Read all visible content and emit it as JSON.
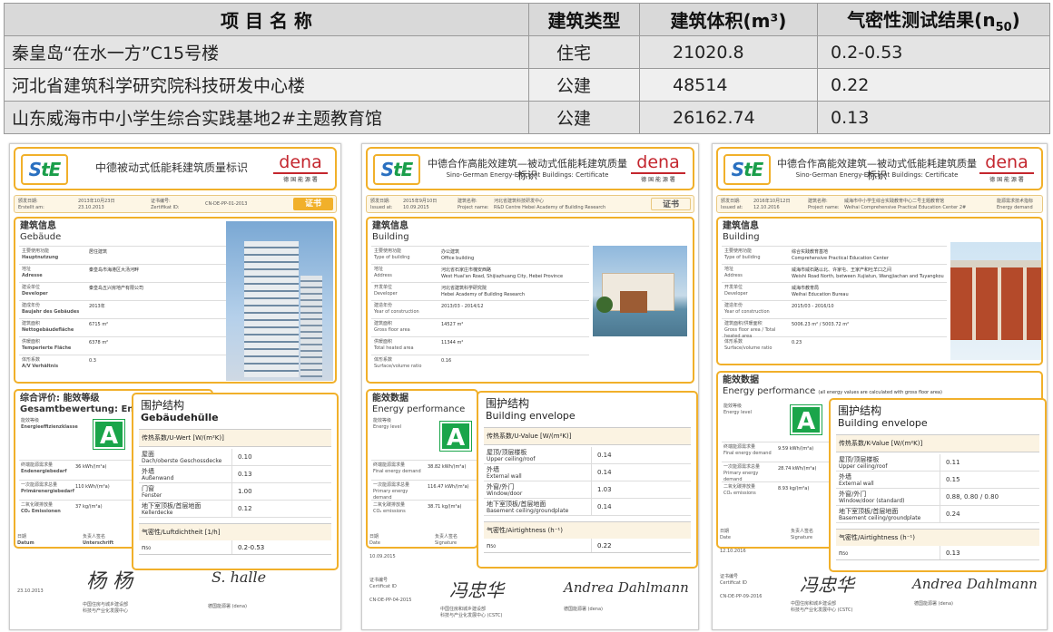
{
  "table": {
    "headers": [
      "项 目 名 称",
      "建筑类型",
      "建筑体积(m³)",
      "气密性测试结果(n",
      "50",
      ")"
    ],
    "rows": [
      {
        "name": "秦皇岛“在水一方”C15号楼",
        "type": "住宅",
        "volume": "21020.8",
        "result": "0.2-0.53"
      },
      {
        "name": "河北省建筑科学研究院科技研发中心楼",
        "type": "公建",
        "volume": "48514",
        "result": "0.22"
      },
      {
        "name": "山东威海市中小学生综合实践基地2#主题教育馆",
        "type": "公建",
        "volume": "26162.74",
        "result": "0.13"
      }
    ]
  },
  "cert1": {
    "title": "中德被动式低能耗建筑质量标识",
    "meta": [
      "颁发日期:",
      "Erstellt am:",
      "2013年10月23日",
      "23.10.2013",
      "证书编号:",
      "Zertifikat ID:",
      "CN-DE-PP-01-2013"
    ],
    "badge": "证书",
    "building_title": "建筑信息",
    "building_title_en": "Gebäude",
    "rows": [
      {
        "k": "主要使用功能",
        "k_en": "Hauptnutzung",
        "v": "居住建筑"
      },
      {
        "k": "地址",
        "k_en": "Adresse",
        "v": "秦皇岛市海港区大汤河畔"
      },
      {
        "k": "建设单位",
        "k_en": "Developer",
        "v": "秦皇岛五兴房地产有限公司"
      },
      {
        "k": "建成年份",
        "k_en": "Baujahr des Gebäudes",
        "v": "2013年"
      },
      {
        "k": "建筑面积",
        "k_en": "Nettogebäudefläche",
        "v": "6715 m²"
      },
      {
        "k": "供暖面积",
        "k_en": "Temperierte Fläche",
        "v": "6378 m²"
      },
      {
        "k": "体形系数",
        "k_en": "A/V Verhältnis",
        "v": "0.3"
      }
    ],
    "eval_title": "综合评价: 能效等级",
    "eval_title_en": "Gesamtbewertung: Energie",
    "eval_label": "能效等级",
    "eval_label_en": "Energieeffizienzklasse",
    "grade": "A",
    "eval_rows": [
      {
        "k": "终端能源需求量",
        "k_en": "Endenergiebedarf",
        "v": "36 kWh/(m²a)"
      },
      {
        "k": "一次能源需求总量",
        "k_en": "Primärenergiebedarf",
        "v": "110 kWh/(m²a)"
      },
      {
        "k": "二氧化碳排放量",
        "k_en": "CO₂ Emissionen",
        "v": "37 kg/(m²a)"
      }
    ],
    "env_title": "围护结构",
    "env_title_en": "Gebäudehülle",
    "env_head": "传热系数/U-Wert [W/(m²K)]",
    "env_rows": [
      {
        "k": "屋面",
        "k_en": "Dach/oberste Geschossdecke",
        "v": "0.10"
      },
      {
        "k": "外墙",
        "k_en": "Außenwand",
        "v": "0.13"
      },
      {
        "k": "门窗",
        "k_en": "Fenster",
        "v": "1.00"
      },
      {
        "k": "地下室顶板/首层地面",
        "k_en": "Kellerdecke",
        "v": "0.12"
      }
    ],
    "air_label": "气密性/Luftdichtheit [1/h]",
    "n50_label": "n₅₀",
    "n50_value": "0.2-0.53",
    "foot": [
      "日期",
      "Datum",
      "负责人签名",
      "Unterschrift",
      "23.10.2013",
      "中国住房与城乡建设部",
      "科技与产业化发展中心",
      "德国能源署 (dena)"
    ],
    "sig1": "杨 杨",
    "sig2": "S. halle"
  },
  "cert2": {
    "title": "中德合作高能效建筑—被动式低能耗建筑质量标识",
    "subtitle": "Sino-German Energy-Efficient Buildings: Certificate",
    "meta": [
      "颁发日期:",
      "Issued at:",
      "2015年9月10日",
      "10.09.2015",
      "建筑名称:",
      "Project name:",
      "河北省建筑科技研发中心",
      "R&D Centre Hebei Academy of Building Research"
    ],
    "badge": "证书",
    "building_title": "建筑信息",
    "building_title_en": "Building",
    "rows": [
      {
        "k": "主要使用功能",
        "k_en": "Type of building",
        "v": "办公建筑",
        "v_en": "Office building"
      },
      {
        "k": "地址",
        "k_en": "Address",
        "v": "河北省石家庄市槐安西路",
        "v_en": "West Huai'an Road, Shijiazhuang City, Hebei Province"
      },
      {
        "k": "开发单位",
        "k_en": "Developer",
        "v": "河北省建筑科学研究院",
        "v_en": "Hebei Academy of Building Research"
      },
      {
        "k": "建造年份",
        "k_en": "Year of construction",
        "v": "2013/03 - 2014/12",
        "v_en": ""
      },
      {
        "k": "建筑面积",
        "k_en": "Gross floor area",
        "v": "14527 m²",
        "v_en": ""
      },
      {
        "k": "供暖面积",
        "k_en": "Total heated area",
        "v": "11344 m²",
        "v_en": ""
      },
      {
        "k": "体形系数",
        "k_en": "Surface/volume ratio",
        "v": "0.16",
        "v_en": ""
      }
    ],
    "eval_title": "能效数据",
    "eval_title_en": "Energy performance",
    "eval_label": "能效等级",
    "eval_label_en": "Energy level",
    "grade": "A",
    "eval_rows": [
      {
        "k": "终端能源需求量",
        "k_en": "Final energy demand",
        "v": "38.82 kWh/(m²a)"
      },
      {
        "k": "一次能源需求总量",
        "k_en": "Primary energy demand",
        "v": "116.47 kWh/(m²a)"
      },
      {
        "k": "二氧化碳排放量",
        "k_en": "CO₂ emissions",
        "v": "38.71 kg/(m²a)"
      }
    ],
    "env_title": "围护结构",
    "env_title_en": "Building envelope",
    "env_head": "传热系数/U-Value [W/(m²K)]",
    "env_rows": [
      {
        "k": "屋顶/顶层楼板",
        "k_en": "Upper ceiling/roof",
        "v": "0.14"
      },
      {
        "k": "外墙",
        "k_en": "External wall",
        "v": "0.14"
      },
      {
        "k": "外窗/外门",
        "k_en": "Window/door",
        "v": "1.03"
      },
      {
        "k": "地下室顶板/首层地面",
        "k_en": "Basement ceiling/groundplate",
        "v": "0.14"
      }
    ],
    "air_label": "气密性/Airtightness (h⁻¹)",
    "n50_label": "n₅₀",
    "n50_value": "0.22",
    "foot": [
      "日期",
      "Date",
      "负责人签名",
      "Signature",
      "10.09.2015",
      "证书编号",
      "Certificat ID",
      "CN-DE-PP-04-2015",
      "中国住房和城乡建设部",
      "科技与产业化发展中心 (CSTC)",
      "德国能源署 (dena)"
    ],
    "sig1": "冯忠华",
    "sig2": "Andrea Dahlmann"
  },
  "cert3": {
    "title": "中德合作高能效建筑—被动式低能耗建筑质量标识",
    "subtitle": "Sino-German Energy-Efficient Buildings: Certificate",
    "meta": [
      "颁发日期:",
      "Issued at:",
      "2016年10月12日",
      "12.10.2016",
      "建筑名称:",
      "Project name:",
      "威海市中小学生综合实践教育中心二号主题教育馆",
      "Weihai Comprehensive Practical Education Center 2#"
    ],
    "badge": "能源需求技术指标",
    "badge_en": "Energy demand",
    "building_title": "建筑信息",
    "building_title_en": "Building",
    "rows": [
      {
        "k": "主要使用功能",
        "k_en": "Type of building",
        "v": "综合实践教育基地",
        "v_en": "Comprehensive Practical Education Center"
      },
      {
        "k": "地址",
        "k_en": "Address",
        "v": "威海市威石路以北、许家屯、王家产和吐羊口之间",
        "v_en": "Weishi Road North, between Xujiatun, Wangjiachan and Tuyangkou"
      },
      {
        "k": "开发单位",
        "k_en": "Developer",
        "v": "威海市教育局",
        "v_en": "Weihai Education Bureau"
      },
      {
        "k": "建造年份",
        "k_en": "Year of construction",
        "v": "2015/03 - 2016/10",
        "v_en": ""
      },
      {
        "k": "建筑面积/供暖面积",
        "k_en": "Gross floor area / Total heated area",
        "v": "5006.23 m² / 5003.72 m²",
        "v_en": ""
      },
      {
        "k": "体形系数",
        "k_en": "Surface/volume ratio",
        "v": "0.23",
        "v_en": ""
      }
    ],
    "eval_title": "能效数据",
    "eval_title_en": "Energy performance",
    "eval_note": "(all energy values are calculated with gross floor area)",
    "eval_label": "能效等级",
    "eval_label_en": "Energy level",
    "grade": "A",
    "eval_rows": [
      {
        "k": "终端能源需求量",
        "k_en": "Final energy demand",
        "v": "9.59 kWh/(m²a)"
      },
      {
        "k": "一次能源需求总量",
        "k_en": "Primary energy demand",
        "v": "28.74 kWh/(m²a)"
      },
      {
        "k": "二氧化碳排放量",
        "k_en": "CO₂ emissions",
        "v": "8.93 kg/(m²a)"
      }
    ],
    "env_title": "围护结构",
    "env_title_en": "Building envelope",
    "env_head": "传热系数/K-Value [W/(m²K)]",
    "env_rows": [
      {
        "k": "屋顶/顶层楼板",
        "k_en": "Upper ceiling/roof",
        "v": "0.11"
      },
      {
        "k": "外墙",
        "k_en": "External wall",
        "v": "0.15"
      },
      {
        "k": "外窗/外门",
        "k_en": "Window/door (standard)",
        "v": "0.88, 0.80 / 0.80"
      },
      {
        "k": "地下室顶板/首层地面",
        "k_en": "Basement ceiling/groundplate",
        "v": "0.24"
      }
    ],
    "air_label": "气密性/Airtightness (h⁻¹)",
    "n50_label": "n₅₀",
    "n50_value": "0.13",
    "foot": [
      "日期",
      "Date",
      "负责人签名",
      "Signature",
      "12.10.2016",
      "证书编号",
      "Certificat ID",
      "CN-DE-PP-09-2016",
      "中国住房和城乡建设部",
      "科技与产业化发展中心 (CSTC)",
      "德国能源署 (dena)"
    ],
    "sig1": "冯忠华",
    "sig2": "Andrea Dahlmann"
  },
  "dena": {
    "word": "dena",
    "sub": "德 国 能 源 署"
  },
  "logo": {
    "text_a": "S",
    "text_b": "tE"
  },
  "colors": {
    "accent": "#f1b02a",
    "grade": "#1aa54a",
    "dena": "#c4262e",
    "header_bg": "#d9d9d9",
    "row_bg": "#efefef"
  }
}
